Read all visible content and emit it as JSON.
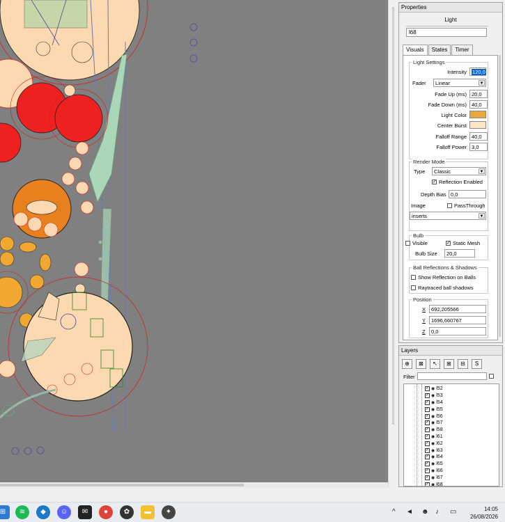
{
  "properties": {
    "title": "Properties",
    "object_type": "Light",
    "name": "l68",
    "tabs": [
      {
        "label": "Visuals",
        "active": true
      },
      {
        "label": "States",
        "active": false
      },
      {
        "label": "Timer",
        "active": false
      }
    ],
    "light_settings": {
      "group_label": "Light Settings",
      "intensity_label": "Intensity",
      "intensity_value": "120,0",
      "fader_label": "Fader",
      "fader_value": "Linear",
      "fade_up_label": "Fade Up (ms)",
      "fade_up_value": "20,0",
      "fade_down_label": "Fade Down (ms)",
      "fade_down_value": "40,0",
      "light_color_label": "Light Color",
      "light_color": "#e8a93a",
      "center_burst_label": "Center Burst",
      "center_burst_color": "#fbe4c6",
      "falloff_range_label": "Falloff Range",
      "falloff_range_value": "40,0",
      "falloff_power_label": "Falloff Power",
      "falloff_power_value": "3,0"
    },
    "render_mode": {
      "group_label": "Render Mode",
      "type_label": "Type",
      "type_value": "Classic",
      "reflection_enabled_label": "Reflection Enabled",
      "reflection_enabled": true,
      "depth_bias_label": "Depth Bias",
      "depth_bias_value": "0,0",
      "image_label": "Image",
      "passthrough_label": "PassThrough",
      "passthrough": false,
      "image_value": "inserts"
    },
    "bulb": {
      "group_label": "Bulb",
      "visible_label": "Visible",
      "visible": false,
      "static_mesh_label": "Static Mesh",
      "static_mesh": true,
      "bulb_size_label": "Bulb Size",
      "bulb_size_value": "20,0"
    },
    "ball_reflections": {
      "group_label": "Ball Reflections & Shadows",
      "show_reflection_label": "Show Reflection on Balls",
      "show_reflection": false,
      "raytraced_label": "Raytraced ball shadows",
      "raytraced": false
    },
    "position": {
      "group_label": "Position",
      "x_label": "X",
      "x_value": "692,205566",
      "y_label": "Y",
      "y_value": "1696,660767",
      "z_label": "Z",
      "z_value": "0,0"
    }
  },
  "layers": {
    "title": "Layers",
    "toolbar": [
      "layer-add",
      "layer-toggle",
      "select",
      "expand",
      "collapse",
      "S"
    ],
    "filter_label": "Filter",
    "filter_value": "",
    "items": [
      "l52",
      "l53",
      "l54",
      "l55",
      "l56",
      "l57",
      "l58",
      "l61",
      "l62",
      "l63",
      "l64",
      "l65",
      "l66",
      "l67",
      "l68"
    ]
  },
  "taskbar": {
    "apps": [
      "windows-icon",
      "spotify-icon",
      "shield-icon",
      "discord-icon",
      "notification-app-icon",
      "chrome-icon",
      "chatgpt-icon",
      "folder-icon",
      "pinball-icon"
    ],
    "time": "14:05",
    "date": "26/08/2026"
  }
}
